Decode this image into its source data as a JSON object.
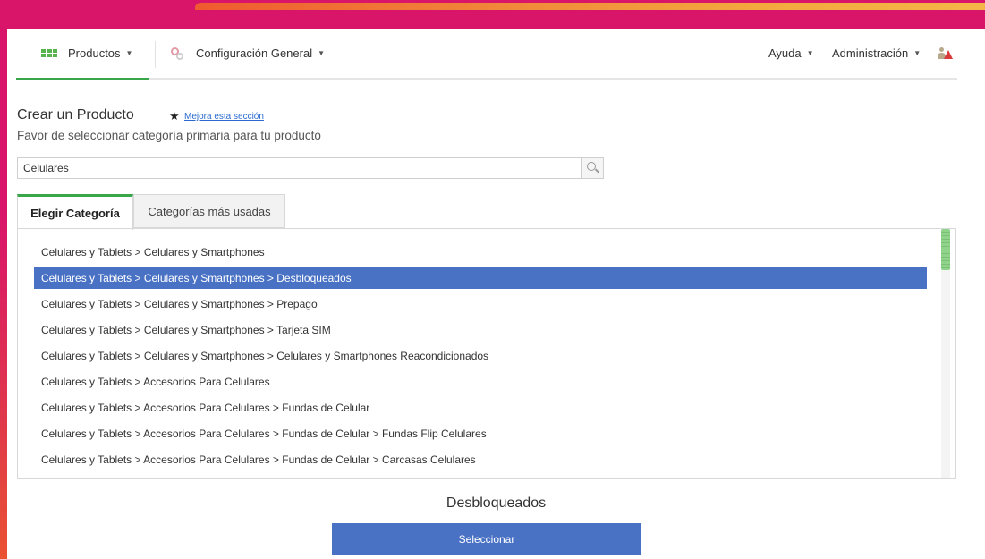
{
  "nav": {
    "productos": "Productos",
    "config": "Configuración General",
    "ayuda": "Ayuda",
    "admin": "Administración"
  },
  "header": {
    "title": "Crear un Producto",
    "improve_link": "Mejora esta sección",
    "subtitle": "Favor de seleccionar categoría primaria para tu producto"
  },
  "search": {
    "value": "Celulares"
  },
  "tabs": {
    "choose": "Elegir Categoría",
    "most_used": "Categorías más usadas"
  },
  "categories": [
    "Celulares y Tablets > Celulares y Smartphones",
    "Celulares y Tablets > Celulares y Smartphones > Desbloqueados",
    "Celulares y Tablets > Celulares y Smartphones > Prepago",
    "Celulares y Tablets > Celulares y Smartphones > Tarjeta SIM",
    "Celulares y Tablets > Celulares y Smartphones > Celulares y Smartphones Reacondicionados",
    "Celulares y Tablets > Accesorios Para Celulares",
    "Celulares y Tablets > Accesorios Para Celulares > Fundas de Celular",
    "Celulares y Tablets > Accesorios Para Celulares > Fundas de Celular > Fundas Flip Celulares",
    "Celulares y Tablets > Accesorios Para Celulares > Fundas de Celular > Carcasas Celulares"
  ],
  "selected_index": 1,
  "selected_label": "Desbloqueados",
  "select_button": "Seleccionar",
  "colors": {
    "accent_green": "#3aa64a",
    "selection_blue": "#4a72c4",
    "frame": "#d9156a"
  }
}
